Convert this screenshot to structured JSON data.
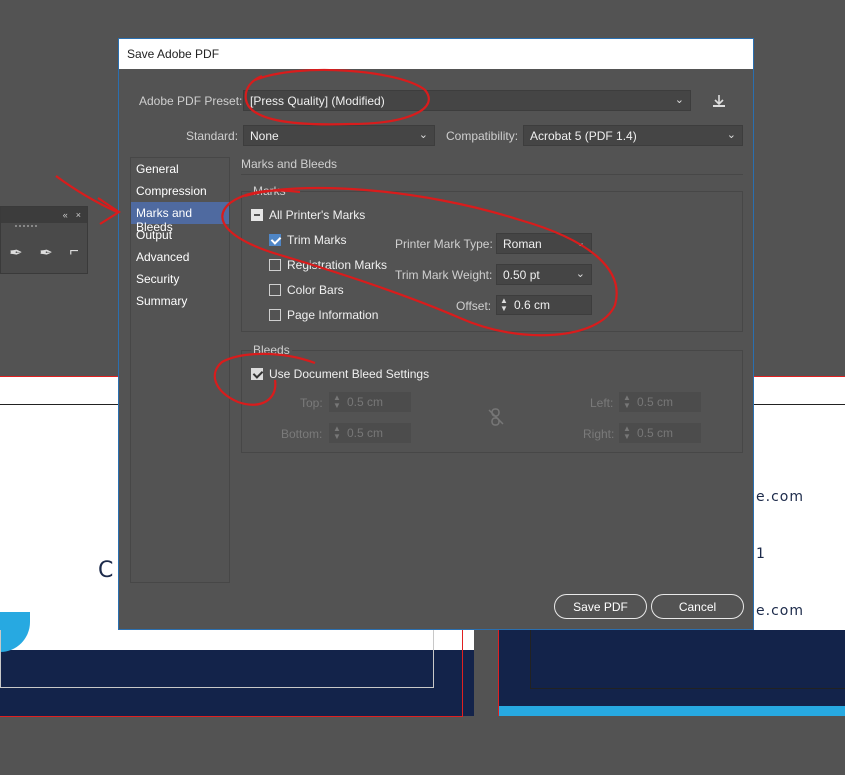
{
  "background": {
    "right_card_text_1": "e.com",
    "right_card_text_2": "1",
    "right_card_text_3": "e.com",
    "left_card_text": "C"
  },
  "tool_panel": {
    "collapse_glyph": "«",
    "close_glyph": "×"
  },
  "dialog": {
    "title": "Save Adobe PDF",
    "preset_label": "Adobe PDF Preset:",
    "preset_value": "[Press Quality] (Modified)",
    "standard_label": "Standard:",
    "standard_value": "None",
    "compat_label": "Compatibility:",
    "compat_value": "Acrobat 5 (PDF 1.4)",
    "nav": [
      {
        "label": "General"
      },
      {
        "label": "Compression"
      },
      {
        "label": "Marks and Bleeds"
      },
      {
        "label": "Output"
      },
      {
        "label": "Advanced"
      },
      {
        "label": "Security"
      },
      {
        "label": "Summary"
      }
    ],
    "section_title": "Marks and Bleeds",
    "marks": {
      "group_label": "Marks",
      "all_printers": "All Printer's Marks",
      "trim": "Trim Marks",
      "registration": "Registration Marks",
      "color_bars": "Color Bars",
      "page_info": "Page Information",
      "type_label": "Printer Mark Type:",
      "type_value": "Roman",
      "weight_label": "Trim Mark Weight:",
      "weight_value": "0.50 pt",
      "offset_label": "Offset:",
      "offset_value": "0.6 cm"
    },
    "bleeds": {
      "group_label": "Bleeds",
      "use_doc": "Use Document Bleed Settings",
      "top_label": "Top:",
      "top_value": "0.5 cm",
      "bottom_label": "Bottom:",
      "bottom_value": "0.5 cm",
      "left_label": "Left:",
      "left_value": "0.5 cm",
      "right_label": "Right:",
      "right_value": "0.5 cm"
    },
    "save_button": "Save PDF",
    "cancel_button": "Cancel"
  },
  "colors": {
    "accent": "#4f86c6",
    "annotation_red": "#d91c1c"
  }
}
